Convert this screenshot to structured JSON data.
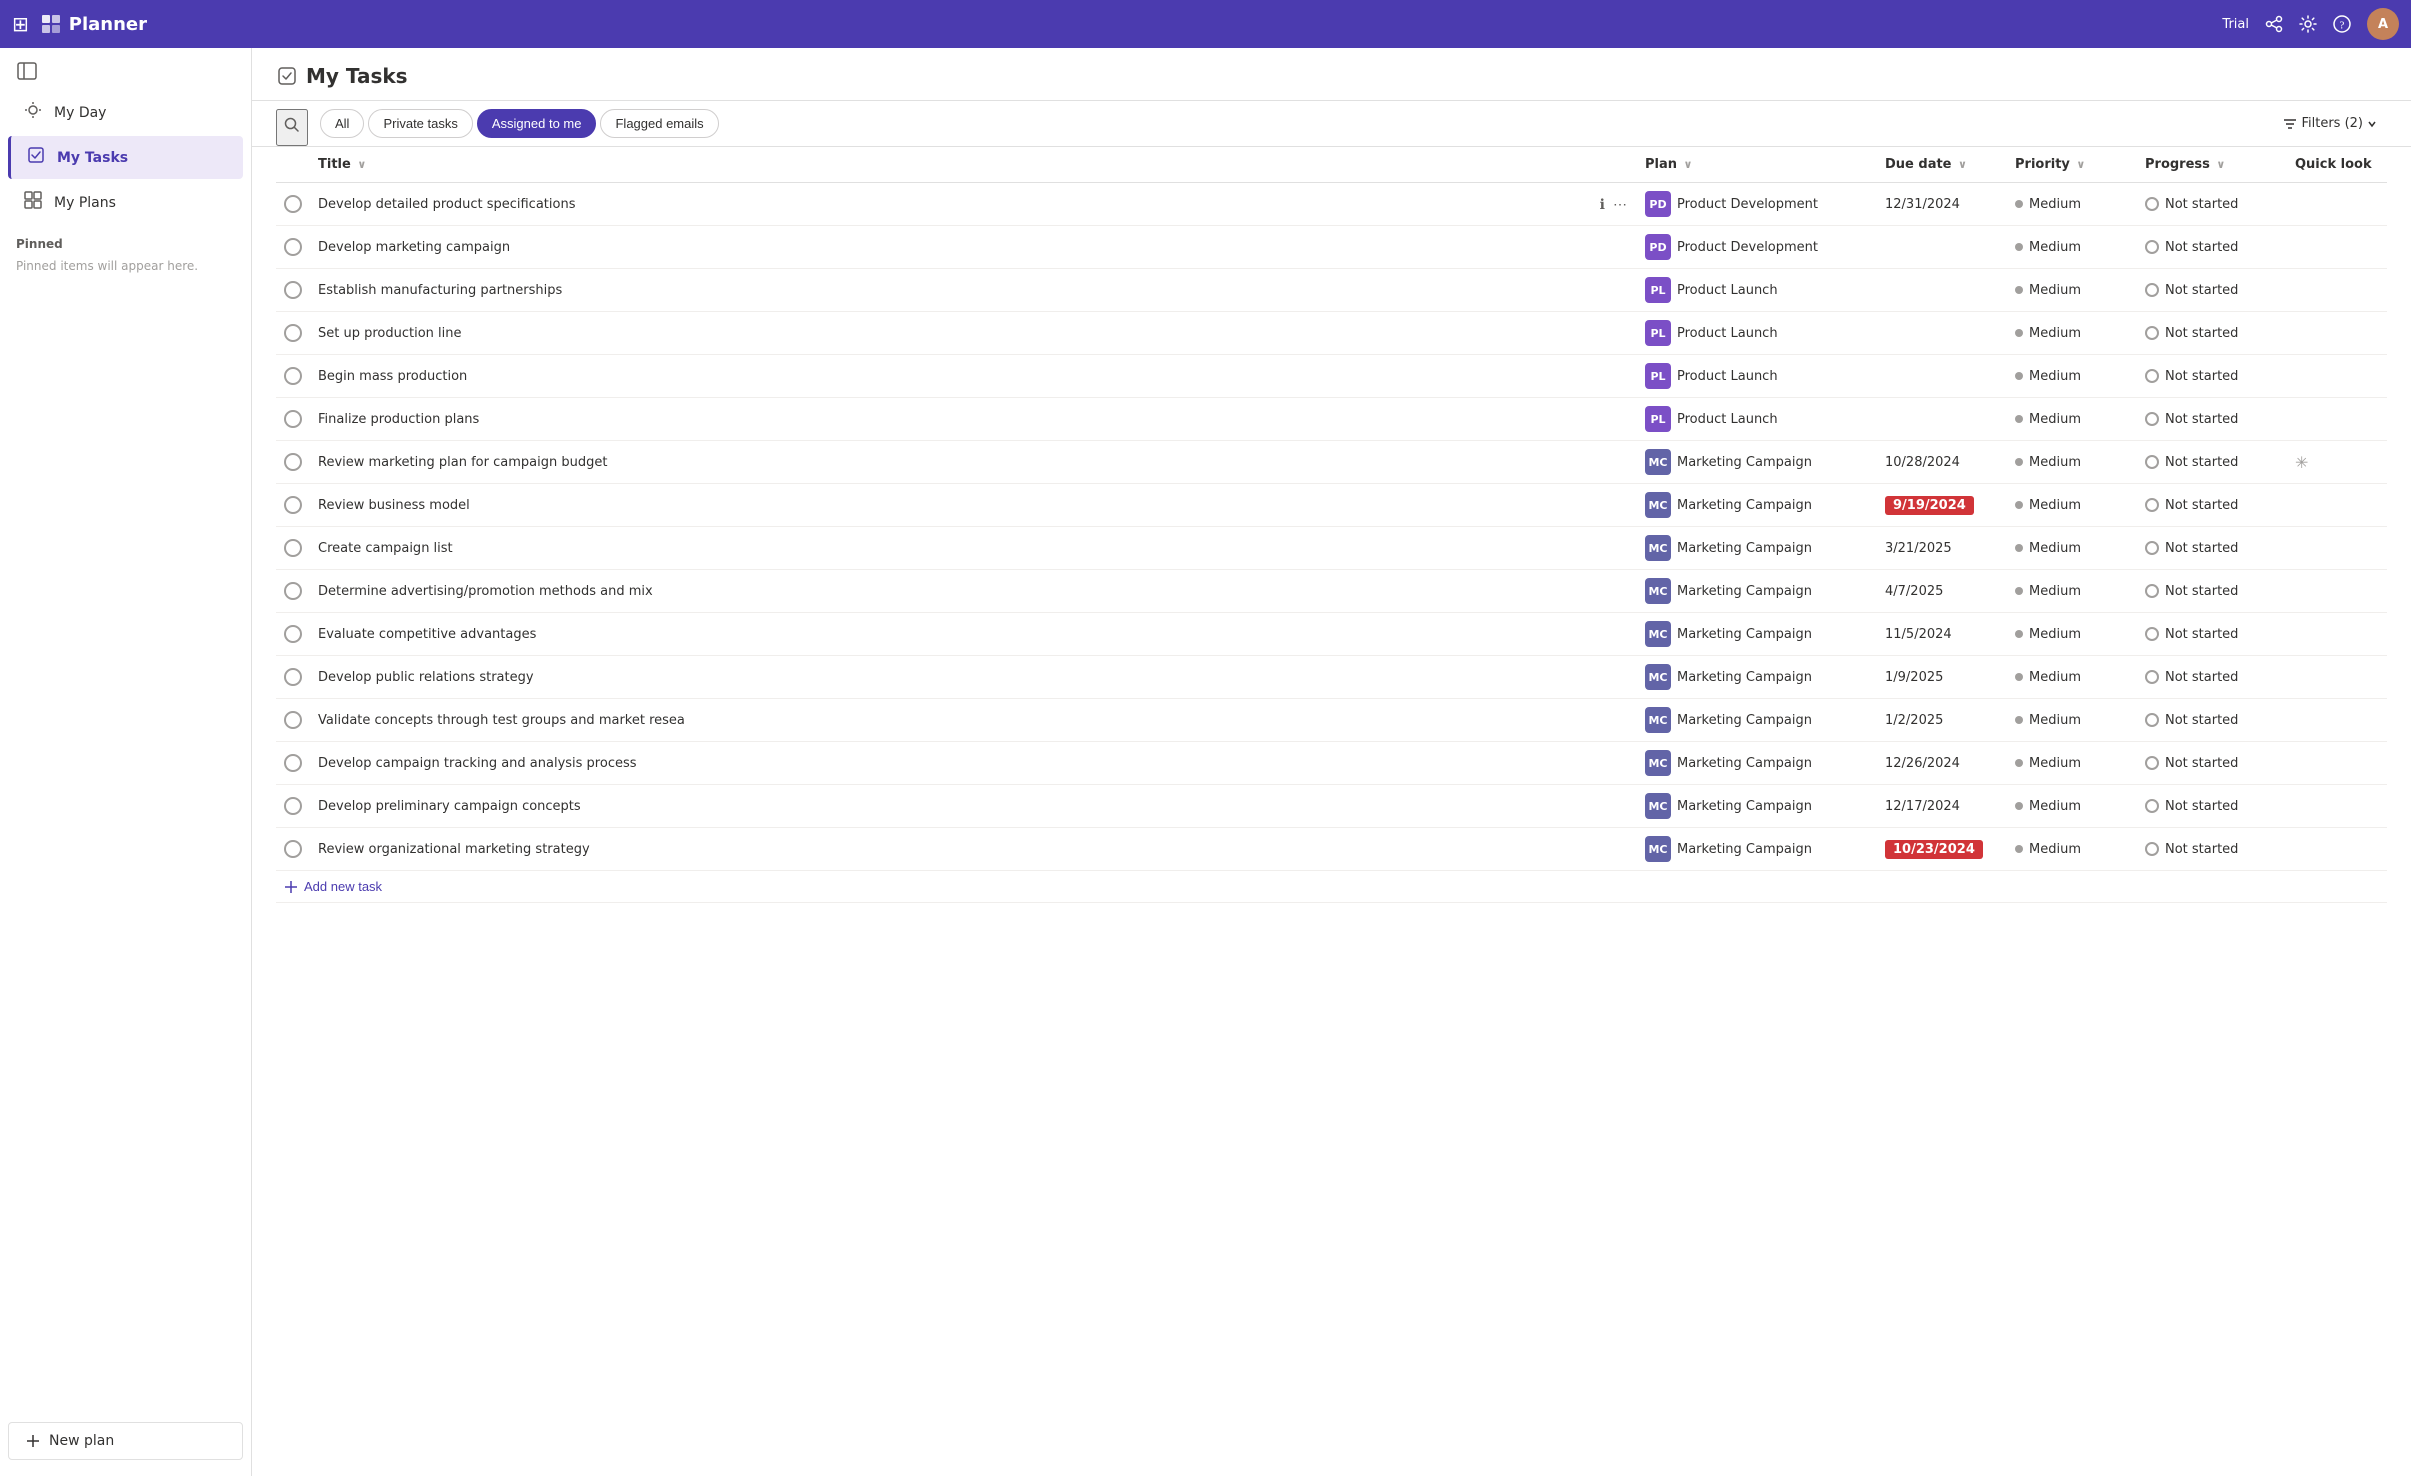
{
  "topbar": {
    "app_name": "Planner",
    "trial_label": "Trial",
    "waffle_icon": "⊞",
    "share_icon": "🔗",
    "settings_icon": "⚙",
    "help_icon": "?",
    "avatar_initials": "A"
  },
  "sidebar": {
    "collapse_icon": "◧",
    "items": [
      {
        "id": "my-day",
        "icon": "☀",
        "label": "My Day",
        "active": false
      },
      {
        "id": "my-tasks",
        "icon": "✔",
        "label": "My Tasks",
        "active": true
      },
      {
        "id": "my-plans",
        "icon": "⊞",
        "label": "My Plans",
        "active": false
      }
    ],
    "pinned_section": "Pinned",
    "pinned_note": "Pinned items will appear here.",
    "new_plan_label": "New plan",
    "new_plan_icon": "+"
  },
  "main": {
    "title": "My Tasks",
    "title_icon": "⊙",
    "tabs": [
      {
        "id": "all",
        "label": "All",
        "active": false
      },
      {
        "id": "private-tasks",
        "label": "Private tasks",
        "active": false
      },
      {
        "id": "assigned-to-me",
        "label": "Assigned to me",
        "active": true
      },
      {
        "id": "flagged-emails",
        "label": "Flagged emails",
        "active": false
      }
    ],
    "filters_label": "Filters (2)",
    "filters_icon": "⊟",
    "columns": [
      {
        "id": "title",
        "label": "Title",
        "sort": true
      },
      {
        "id": "plan",
        "label": "Plan",
        "sort": true
      },
      {
        "id": "due-date",
        "label": "Due date",
        "sort": true
      },
      {
        "id": "priority",
        "label": "Priority",
        "sort": true
      },
      {
        "id": "progress",
        "label": "Progress",
        "sort": true
      },
      {
        "id": "quick-look",
        "label": "Quick look",
        "sort": false
      }
    ],
    "tasks": [
      {
        "id": 1,
        "title": "Develop detailed product specifications",
        "plan": "Product Development",
        "plan_abbr": "PD",
        "plan_color": "pd",
        "due_date": "12/31/2024",
        "due_overdue": false,
        "priority": "Medium",
        "progress": "Not started",
        "quick_look": false
      },
      {
        "id": 2,
        "title": "Develop marketing campaign",
        "plan": "Product Development",
        "plan_abbr": "PD",
        "plan_color": "pd",
        "due_date": "",
        "due_overdue": false,
        "priority": "Medium",
        "progress": "Not started",
        "quick_look": false
      },
      {
        "id": 3,
        "title": "Establish manufacturing partnerships",
        "plan": "Product Launch",
        "plan_abbr": "PL",
        "plan_color": "pl",
        "due_date": "",
        "due_overdue": false,
        "priority": "Medium",
        "progress": "Not started",
        "quick_look": false
      },
      {
        "id": 4,
        "title": "Set up production line",
        "plan": "Product Launch",
        "plan_abbr": "PL",
        "plan_color": "pl",
        "due_date": "",
        "due_overdue": false,
        "priority": "Medium",
        "progress": "Not started",
        "quick_look": false
      },
      {
        "id": 5,
        "title": "Begin mass production",
        "plan": "Product Launch",
        "plan_abbr": "PL",
        "plan_color": "pl",
        "due_date": "",
        "due_overdue": false,
        "priority": "Medium",
        "progress": "Not started",
        "quick_look": false
      },
      {
        "id": 6,
        "title": "Finalize production plans",
        "plan": "Product Launch",
        "plan_abbr": "PL",
        "plan_color": "pl",
        "due_date": "",
        "due_overdue": false,
        "priority": "Medium",
        "progress": "Not started",
        "quick_look": false
      },
      {
        "id": 7,
        "title": "Review marketing plan for campaign budget",
        "plan": "Marketing Campaign",
        "plan_abbr": "MC",
        "plan_color": "mc",
        "due_date": "10/28/2024",
        "due_overdue": false,
        "priority": "Medium",
        "progress": "Not started",
        "quick_look": true
      },
      {
        "id": 8,
        "title": "Review business model",
        "plan": "Marketing Campaign",
        "plan_abbr": "MC",
        "plan_color": "mc",
        "due_date": "9/19/2024",
        "due_overdue": true,
        "priority": "Medium",
        "progress": "Not started",
        "quick_look": false
      },
      {
        "id": 9,
        "title": "Create campaign list",
        "plan": "Marketing Campaign",
        "plan_abbr": "MC",
        "plan_color": "mc",
        "due_date": "3/21/2025",
        "due_overdue": false,
        "priority": "Medium",
        "progress": "Not started",
        "quick_look": false
      },
      {
        "id": 10,
        "title": "Determine advertising/promotion methods and mix",
        "plan": "Marketing Campaign",
        "plan_abbr": "MC",
        "plan_color": "mc",
        "due_date": "4/7/2025",
        "due_overdue": false,
        "priority": "Medium",
        "progress": "Not started",
        "quick_look": false
      },
      {
        "id": 11,
        "title": "Evaluate competitive advantages",
        "plan": "Marketing Campaign",
        "plan_abbr": "MC",
        "plan_color": "mc",
        "due_date": "11/5/2024",
        "due_overdue": false,
        "priority": "Medium",
        "progress": "Not started",
        "quick_look": false
      },
      {
        "id": 12,
        "title": "Develop public relations strategy",
        "plan": "Marketing Campaign",
        "plan_abbr": "MC",
        "plan_color": "mc",
        "due_date": "1/9/2025",
        "due_overdue": false,
        "priority": "Medium",
        "progress": "Not started",
        "quick_look": false
      },
      {
        "id": 13,
        "title": "Validate concepts through test groups and market resea",
        "plan": "Marketing Campaign",
        "plan_abbr": "MC",
        "plan_color": "mc",
        "due_date": "1/2/2025",
        "due_overdue": false,
        "priority": "Medium",
        "progress": "Not started",
        "quick_look": false
      },
      {
        "id": 14,
        "title": "Develop campaign tracking and analysis process",
        "plan": "Marketing Campaign",
        "plan_abbr": "MC",
        "plan_color": "mc",
        "due_date": "12/26/2024",
        "due_overdue": false,
        "priority": "Medium",
        "progress": "Not started",
        "quick_look": false
      },
      {
        "id": 15,
        "title": "Develop preliminary campaign concepts",
        "plan": "Marketing Campaign",
        "plan_abbr": "MC",
        "plan_color": "mc",
        "due_date": "12/17/2024",
        "due_overdue": false,
        "priority": "Medium",
        "progress": "Not started",
        "quick_look": false
      },
      {
        "id": 16,
        "title": "Review organizational marketing strategy",
        "plan": "Marketing Campaign",
        "plan_abbr": "MC",
        "plan_color": "mc",
        "due_date": "10/23/2024",
        "due_overdue": true,
        "priority": "Medium",
        "progress": "Not started",
        "quick_look": false
      }
    ],
    "add_task_label": "Add new task",
    "add_task_icon": "+"
  }
}
